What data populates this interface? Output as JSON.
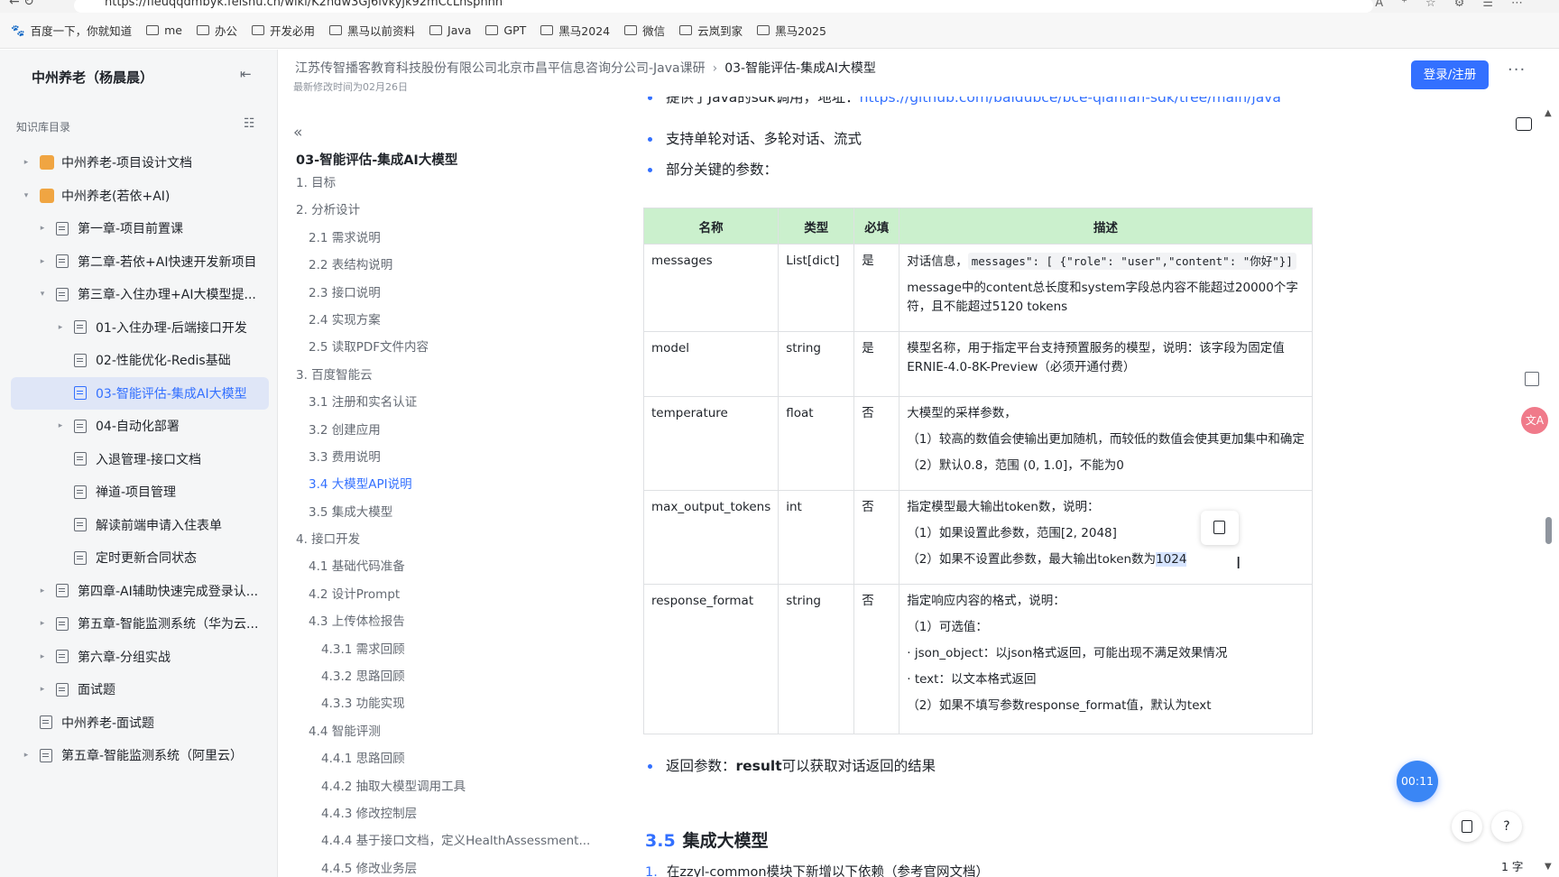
{
  "browser": {
    "url": "https://fleuqqdmbyk.feishu.cn/wiki/K2ndw3Gj6lvkyjk92mCcLhspnhh",
    "nav_glyphs": "←   ↻",
    "right_glyphs": "A⁺☆⚙☰⋯",
    "bookmarks": [
      "百度一下，你就知道",
      "me",
      "办公",
      "开发必用",
      "黑马以前资料",
      "Java",
      "GPT",
      "黑马2024",
      "微信",
      "云岚到家",
      "黑马2025"
    ]
  },
  "sidebar": {
    "title": "中州养老（杨晨晨）",
    "collapse_icon": "⇤",
    "section_label": "知识库目录",
    "section_icon": "☷",
    "items": [
      {
        "label": "中州养老-项目设计文档",
        "level": 1,
        "arrow": "▸",
        "icon": "space"
      },
      {
        "label": "中州养老(若依+AI)",
        "level": 1,
        "arrow": "▾",
        "icon": "space"
      },
      {
        "label": "第一章-项目前置课",
        "level": 2,
        "arrow": "▸",
        "icon": "doc"
      },
      {
        "label": "第二章-若依+AI快速开发新项目",
        "level": 2,
        "arrow": "▸",
        "icon": "doc"
      },
      {
        "label": "第三章-入住办理+AI大模型提...",
        "level": 2,
        "arrow": "▾",
        "icon": "doc"
      },
      {
        "label": "01-入住办理-后端接口开发",
        "level": 3,
        "arrow": "▸",
        "icon": "doc"
      },
      {
        "label": "02-性能优化-Redis基础",
        "level": 3,
        "arrow": "",
        "icon": "doc"
      },
      {
        "label": "03-智能评估-集成AI大模型",
        "level": 3,
        "arrow": "",
        "icon": "doc",
        "active": true
      },
      {
        "label": "04-自动化部署",
        "level": 3,
        "arrow": "▸",
        "icon": "doc"
      },
      {
        "label": "入退管理-接口文档",
        "level": 3,
        "arrow": "",
        "icon": "doc"
      },
      {
        "label": "禅道-项目管理",
        "level": 3,
        "arrow": "",
        "icon": "doc"
      },
      {
        "label": "解读前端申请入住表单",
        "level": 3,
        "arrow": "",
        "icon": "doc"
      },
      {
        "label": "定时更新合同状态",
        "level": 3,
        "arrow": "",
        "icon": "doc"
      },
      {
        "label": "第四章-AI辅助快速完成登录认...",
        "level": 2,
        "arrow": "▸",
        "icon": "doc"
      },
      {
        "label": "第五章-智能监测系统（华为云...",
        "level": 2,
        "arrow": "▸",
        "icon": "doc"
      },
      {
        "label": "第六章-分组实战",
        "level": 2,
        "arrow": "▸",
        "icon": "doc"
      },
      {
        "label": "面试题",
        "level": 2,
        "arrow": "▸",
        "icon": "doc"
      },
      {
        "label": "中州养老-面试题",
        "level": 1,
        "arrow": "",
        "icon": "doc"
      },
      {
        "label": "第五章-智能监测系统（阿里云）",
        "level": 1,
        "arrow": "▸",
        "icon": "doc"
      }
    ]
  },
  "header": {
    "breadcrumb_parent": "江苏传智播客教育科技股份有限公司北京市昌平信息咨询分公司-Java课研",
    "breadcrumb_sep": "›",
    "breadcrumb_current": "03-智能评估-集成AI大模型",
    "modified": "最新修改时间为02月26日",
    "login_label": "登录/注册",
    "more_label": "···"
  },
  "outline": {
    "back_icon": "«",
    "title": "03-智能评估-集成AI大模型",
    "items": [
      {
        "label": "1. 目标",
        "level": 1
      },
      {
        "label": "2. 分析设计",
        "level": 1
      },
      {
        "label": "2.1 需求说明",
        "level": 2
      },
      {
        "label": "2.2 表结构说明",
        "level": 2
      },
      {
        "label": "2.3 接口说明",
        "level": 2
      },
      {
        "label": "2.4 实现方案",
        "level": 2
      },
      {
        "label": "2.5 读取PDF文件内容",
        "level": 2
      },
      {
        "label": "3. 百度智能云",
        "level": 1
      },
      {
        "label": "3.1 注册和实名认证",
        "level": 2
      },
      {
        "label": "3.2 创建应用",
        "level": 2
      },
      {
        "label": "3.3 费用说明",
        "level": 2
      },
      {
        "label": "3.4 大模型API说明",
        "level": 2,
        "active": true
      },
      {
        "label": "3.5 集成大模型",
        "level": 2
      },
      {
        "label": "4. 接口开发",
        "level": 1
      },
      {
        "label": "4.1 基础代码准备",
        "level": 2
      },
      {
        "label": "4.2 设计Prompt",
        "level": 2
      },
      {
        "label": "4.3 上传体检报告",
        "level": 2
      },
      {
        "label": "4.3.1 需求回顾",
        "level": 3
      },
      {
        "label": "4.3.2 思路回顾",
        "level": 3
      },
      {
        "label": "4.3.3 功能实现",
        "level": 3
      },
      {
        "label": "4.4 智能评测",
        "level": 2
      },
      {
        "label": "4.4.1 思路回顾",
        "level": 3
      },
      {
        "label": "4.4.2 抽取大模型调用工具",
        "level": 3
      },
      {
        "label": "4.4.3 修改控制层",
        "level": 3
      },
      {
        "label": "4.4.4 基于接口文档，定义HealthAssessment...",
        "level": 3
      },
      {
        "label": "4.4.5 修改业务层",
        "level": 3
      }
    ]
  },
  "content": {
    "bullet0_prefix": "提供了Java的sdk调用，地址：",
    "bullet0_link": "https://github.com/baidubce/bce-qianfan-sdk/tree/main/java",
    "bullet1": "支持单轮对话、多轮对话、流式",
    "bullet2": "部分关键的参数：",
    "table": {
      "headers": [
        "名称",
        "类型",
        "必填",
        "描述"
      ],
      "rows": [
        {
          "name": "messages",
          "type": "List[dict]",
          "required": "是",
          "desc_prefix": "对话信息，",
          "desc_code": "messages\": [ {\"role\": \"user\",\"content\": \"你好\"}]",
          "desc": [
            "message中的content总长度和system字段总内容不能超过20000个字符，且不能超过5120 tokens"
          ]
        },
        {
          "name": "model",
          "type": "string",
          "required": "是",
          "desc": [
            "模型名称，用于指定平台支持预置服务的模型，说明：该字段为固定值ERNIE-4.0-8K-Preview（必须开通付费）"
          ]
        },
        {
          "name": "temperature",
          "type": "float",
          "required": "否",
          "desc": [
            "大模型的采样参数，",
            "（1）较高的数值会使输出更加随机，而较低的数值会使其更加集中和确定",
            "（2）默认0.8，范围 (0, 1.0]，不能为0"
          ]
        },
        {
          "name": "max_output_tokens",
          "type": "int",
          "required": "否",
          "desc": [
            "指定模型最大输出token数，说明：",
            "（1）如果设置此参数，范围[2, 2048]"
          ],
          "desc_last_prefix": "（2）如果不设置此参数，最大输出token数为",
          "desc_last_highlight": "1024"
        },
        {
          "name": "response_format",
          "type": "string",
          "required": "否",
          "desc": [
            "指定响应内容的格式，说明：",
            "（1）可选值：",
            "· json_object：以json格式返回，可能出现不满足效果情况",
            "· text：以文本格式返回",
            "（2）如果不填写参数response_format值，默认为text"
          ]
        }
      ]
    },
    "bullet3_prefix": "返回参数：",
    "bullet3_bold": "result",
    "bullet3_suffix": "可以获取对话返回的结果",
    "h35_num": "3.5",
    "h35_title": "集成大模型",
    "n1_num": "1.",
    "n1_text": "在zzyl-common模块下新增以下依赖（参考官网文档）"
  },
  "floating": {
    "timer": "00:11",
    "help": "?",
    "wordcount": "1 字",
    "translate": "文A",
    "cursor": "I",
    "scroll_up": "▲",
    "scroll_down": "▼"
  }
}
